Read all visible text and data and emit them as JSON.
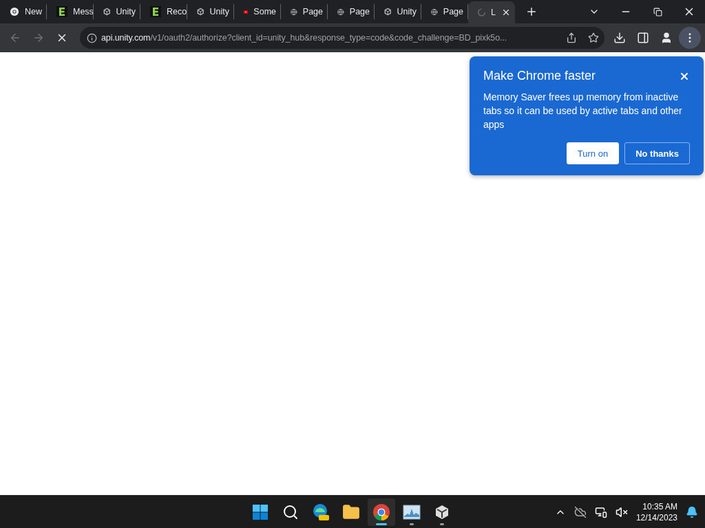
{
  "tabs": [
    {
      "kind": "chrome",
      "title": "New",
      "selected": false
    },
    {
      "kind": "letter-e",
      "title": "Mess",
      "selected": false
    },
    {
      "kind": "unity",
      "title": "Unity",
      "selected": false
    },
    {
      "kind": "letter-e",
      "title": "Reco",
      "selected": false
    },
    {
      "kind": "unity",
      "title": "Unity",
      "selected": false
    },
    {
      "kind": "video",
      "title": "Some",
      "selected": false
    },
    {
      "kind": "globe",
      "title": "Page",
      "selected": false
    },
    {
      "kind": "globe",
      "title": "Page",
      "selected": false
    },
    {
      "kind": "unity",
      "title": "Unity",
      "selected": false
    },
    {
      "kind": "globe",
      "title": "Page",
      "selected": false
    },
    {
      "kind": "spinner",
      "title": "L",
      "selected": true
    }
  ],
  "address_bar": {
    "host": "api.unity.com",
    "path": "/v1/oauth2/authorize?client_id=unity_hub&response_type=code&code_challenge=BD_pixk5o..."
  },
  "popup": {
    "title": "Make Chrome faster",
    "body": "Memory Saver frees up memory from inactive tabs so it can be used by active tabs and other apps",
    "buttons": [
      {
        "label": "Turn on",
        "kind": "primary"
      },
      {
        "label": "No thanks",
        "kind": "secondary"
      }
    ]
  },
  "taskbar": {
    "apps": [
      {
        "kind": "start",
        "running": false,
        "selected": false
      },
      {
        "kind": "search",
        "running": false,
        "selected": false
      },
      {
        "kind": "edge",
        "running": false,
        "selected": false
      },
      {
        "kind": "folder",
        "running": false,
        "selected": false
      },
      {
        "kind": "chrome",
        "running": true,
        "selected": true
      },
      {
        "kind": "monitor",
        "running": true,
        "selected": false
      },
      {
        "kind": "unity",
        "running": true,
        "selected": false
      }
    ],
    "time": "10:35 AM",
    "date": "12/14/2023"
  }
}
